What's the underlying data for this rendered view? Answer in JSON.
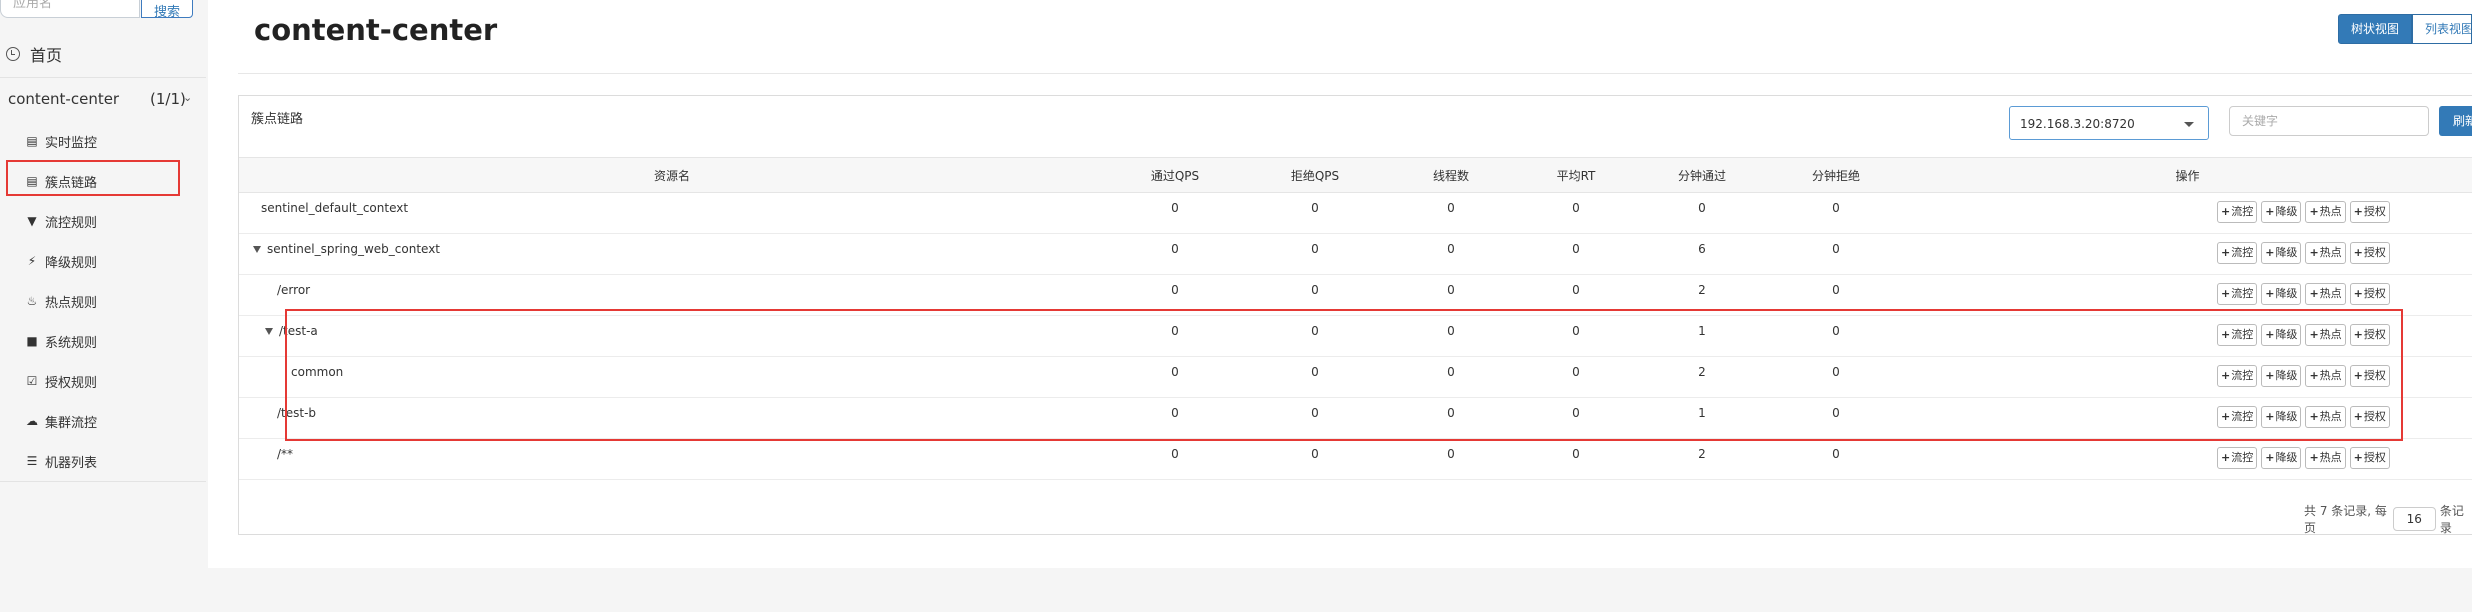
{
  "sidebar": {
    "search_placeholder": "应用名",
    "search_button": "搜索",
    "home": "首页",
    "app": {
      "name": "content-center",
      "count": "(1/1)"
    },
    "items": [
      {
        "label": "实时监控",
        "icon": "bar-chart-icon"
      },
      {
        "label": "簇点链路",
        "icon": "list-icon"
      },
      {
        "label": "流控规则",
        "icon": "filter-icon"
      },
      {
        "label": "降级规则",
        "icon": "bolt-icon"
      },
      {
        "label": "热点规则",
        "icon": "fire-icon"
      },
      {
        "label": "系统规则",
        "icon": "lock-icon"
      },
      {
        "label": "授权规则",
        "icon": "check-square-icon"
      },
      {
        "label": "集群流控",
        "icon": "cloud-icon"
      },
      {
        "label": "机器列表",
        "icon": "th-list-icon"
      }
    ]
  },
  "main": {
    "title": "content-center",
    "view_toggle": {
      "tree": "树状视图",
      "list": "列表视图"
    },
    "panel": {
      "title": "簇点链路",
      "machine": "192.168.3.20:8720",
      "keyword_placeholder": "关键字",
      "refresh": "刷新"
    },
    "table": {
      "headers": [
        "资源名",
        "通过QPS",
        "拒绝QPS",
        "线程数",
        "平均RT",
        "分钟通过",
        "分钟拒绝",
        "操作"
      ],
      "rows": [
        {
          "name": "sentinel_default_context",
          "cols": [
            "0",
            "0",
            "0",
            "0",
            "0",
            "0"
          ]
        },
        {
          "name": "sentinel_spring_web_context",
          "cols": [
            "0",
            "0",
            "0",
            "0",
            "6",
            "0"
          ]
        },
        {
          "name": "/error",
          "cols": [
            "0",
            "0",
            "0",
            "0",
            "2",
            "0"
          ]
        },
        {
          "name": "/test-a",
          "cols": [
            "0",
            "0",
            "0",
            "0",
            "1",
            "0"
          ]
        },
        {
          "name": "common",
          "cols": [
            "0",
            "0",
            "0",
            "0",
            "2",
            "0"
          ]
        },
        {
          "name": "/test-b",
          "cols": [
            "0",
            "0",
            "0",
            "0",
            "1",
            "0"
          ]
        },
        {
          "name": "/**",
          "cols": [
            "0",
            "0",
            "0",
            "0",
            "2",
            "0"
          ]
        }
      ],
      "actions": [
        "流控",
        "降级",
        "热点",
        "授权"
      ]
    },
    "pager": {
      "total": "共 7 条记录, 每页",
      "page_size": "16",
      "suffix": "条记录"
    }
  },
  "colors": {
    "accent": "#337ab7",
    "highlight": "#e53935"
  }
}
